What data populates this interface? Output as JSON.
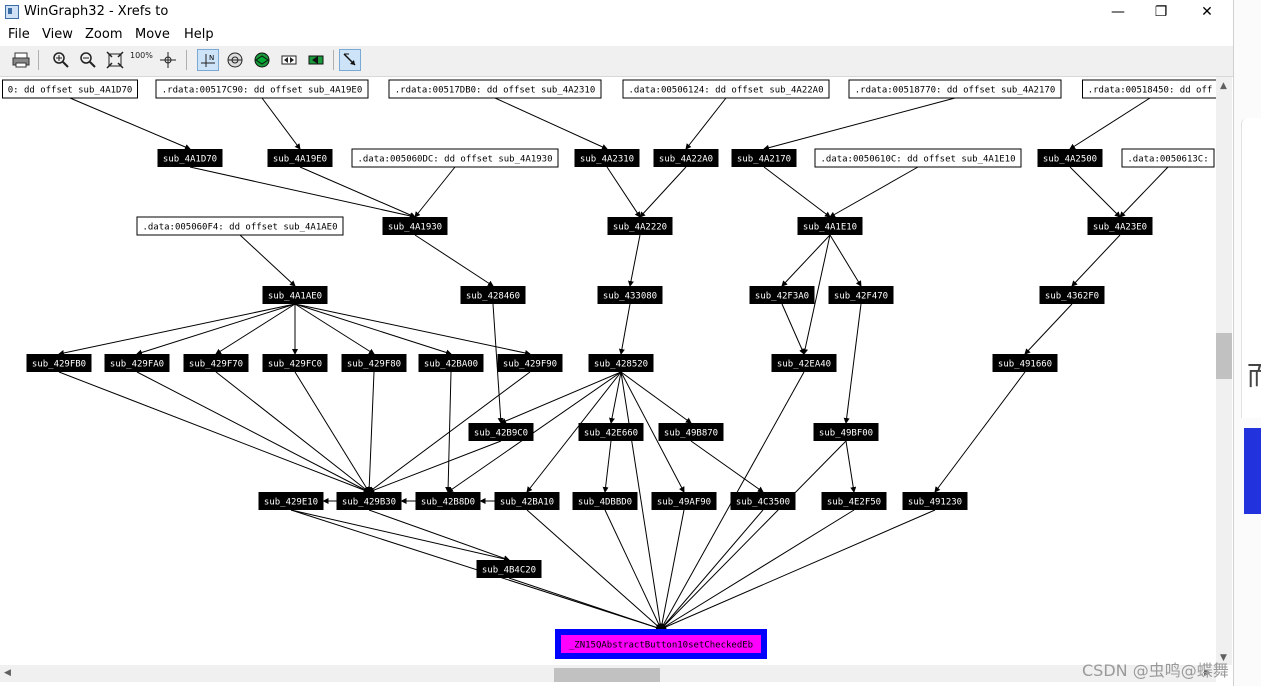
{
  "window": {
    "title": "WinGraph32 - Xrefs to",
    "min_label": "—",
    "max_label": "❐",
    "close_label": "✕"
  },
  "menu": [
    "File",
    "View",
    "Zoom",
    "Move",
    "Help"
  ],
  "toolbar": {
    "zoom_100_label": "100%"
  },
  "graph": {
    "nodes": [
      {
        "id": "n1",
        "label": "0: dd offset sub_4A1D70",
        "kind": "data"
      },
      {
        "id": "n2",
        "label": ".rdata:00517C90: dd offset sub_4A19E0",
        "kind": "data"
      },
      {
        "id": "n3",
        "label": ".rdata:00517DB0: dd offset sub_4A2310",
        "kind": "data"
      },
      {
        "id": "n4",
        "label": ".data:00506124: dd offset sub_4A22A0",
        "kind": "data"
      },
      {
        "id": "n5",
        "label": ".rdata:00518770: dd offset sub_4A2170",
        "kind": "data"
      },
      {
        "id": "n6",
        "label": ".rdata:00518450: dd off",
        "kind": "data"
      },
      {
        "id": "n7",
        "label": "sub_4A1D70",
        "kind": "func"
      },
      {
        "id": "n8",
        "label": "sub_4A19E0",
        "kind": "func"
      },
      {
        "id": "n9",
        "label": ".data:005060DC: dd offset sub_4A1930",
        "kind": "data"
      },
      {
        "id": "n10",
        "label": "sub_4A2310",
        "kind": "func"
      },
      {
        "id": "n11",
        "label": "sub_4A22A0",
        "kind": "func"
      },
      {
        "id": "n12",
        "label": "sub_4A2170",
        "kind": "func"
      },
      {
        "id": "n13",
        "label": ".data:0050610C: dd offset sub_4A1E10",
        "kind": "data"
      },
      {
        "id": "n14",
        "label": "sub_4A2500",
        "kind": "func"
      },
      {
        "id": "n15",
        "label": ".data:0050613C:",
        "kind": "data"
      },
      {
        "id": "n16",
        "label": ".data:005060F4: dd offset sub_4A1AE0",
        "kind": "data"
      },
      {
        "id": "n17",
        "label": "sub_4A1930",
        "kind": "func"
      },
      {
        "id": "n18",
        "label": "sub_4A2220",
        "kind": "func"
      },
      {
        "id": "n19",
        "label": "sub_4A1E10",
        "kind": "func"
      },
      {
        "id": "n20",
        "label": "sub_4A23E0",
        "kind": "func"
      },
      {
        "id": "n21",
        "label": "sub_4A1AE0",
        "kind": "func"
      },
      {
        "id": "n22",
        "label": "sub_428460",
        "kind": "func"
      },
      {
        "id": "n23",
        "label": "sub_433080",
        "kind": "func"
      },
      {
        "id": "n24",
        "label": "sub_42F3A0",
        "kind": "func"
      },
      {
        "id": "n25",
        "label": "sub_42F470",
        "kind": "func"
      },
      {
        "id": "n26",
        "label": "sub_4362F0",
        "kind": "func"
      },
      {
        "id": "n27",
        "label": "sub_429FB0",
        "kind": "func"
      },
      {
        "id": "n28",
        "label": "sub_429FA0",
        "kind": "func"
      },
      {
        "id": "n29",
        "label": "sub_429F70",
        "kind": "func"
      },
      {
        "id": "n30",
        "label": "sub_429FC0",
        "kind": "func"
      },
      {
        "id": "n31",
        "label": "sub_429F80",
        "kind": "func"
      },
      {
        "id": "n32",
        "label": "sub_42BA00",
        "kind": "func"
      },
      {
        "id": "n33",
        "label": "sub_429F90",
        "kind": "func"
      },
      {
        "id": "n34",
        "label": "sub_428520",
        "kind": "func"
      },
      {
        "id": "n35",
        "label": "sub_42EA40",
        "kind": "func"
      },
      {
        "id": "n36",
        "label": "sub_491660",
        "kind": "func"
      },
      {
        "id": "n37",
        "label": "sub_42B9C0",
        "kind": "func"
      },
      {
        "id": "n38",
        "label": "sub_42E660",
        "kind": "func"
      },
      {
        "id": "n39",
        "label": "sub_49B870",
        "kind": "func"
      },
      {
        "id": "n40",
        "label": "sub_49BF00",
        "kind": "func"
      },
      {
        "id": "n41",
        "label": "sub_429E10",
        "kind": "func"
      },
      {
        "id": "n42",
        "label": "sub_429B30",
        "kind": "func"
      },
      {
        "id": "n43",
        "label": "sub_42B8D0",
        "kind": "func"
      },
      {
        "id": "n44",
        "label": "sub_42BA10",
        "kind": "func"
      },
      {
        "id": "n45",
        "label": "sub_4DBBD0",
        "kind": "func"
      },
      {
        "id": "n46",
        "label": "sub_49AF90",
        "kind": "func"
      },
      {
        "id": "n47",
        "label": "sub_4C3500",
        "kind": "func"
      },
      {
        "id": "n48",
        "label": "sub_4E2F50",
        "kind": "func"
      },
      {
        "id": "n49",
        "label": "sub_491230",
        "kind": "func"
      },
      {
        "id": "n50",
        "label": "sub_4B4C20",
        "kind": "func"
      },
      {
        "id": "n51",
        "label": "_ZN15QAbstractButton10setCheckedEb",
        "kind": "target"
      }
    ],
    "edges": [
      [
        "n1",
        "n7"
      ],
      [
        "n2",
        "n8"
      ],
      [
        "n3",
        "n10"
      ],
      [
        "n4",
        "n11"
      ],
      [
        "n5",
        "n12"
      ],
      [
        "n6",
        "n14"
      ],
      [
        "n7",
        "n17"
      ],
      [
        "n8",
        "n17"
      ],
      [
        "n9",
        "n17"
      ],
      [
        "n10",
        "n18"
      ],
      [
        "n11",
        "n18"
      ],
      [
        "n12",
        "n19"
      ],
      [
        "n13",
        "n19"
      ],
      [
        "n14",
        "n20"
      ],
      [
        "n15",
        "n20"
      ],
      [
        "n16",
        "n21"
      ],
      [
        "n17",
        "n22"
      ],
      [
        "n18",
        "n23"
      ],
      [
        "n19",
        "n24"
      ],
      [
        "n19",
        "n25"
      ],
      [
        "n19",
        "n35"
      ],
      [
        "n20",
        "n26"
      ],
      [
        "n21",
        "n27"
      ],
      [
        "n21",
        "n28"
      ],
      [
        "n21",
        "n29"
      ],
      [
        "n21",
        "n30"
      ],
      [
        "n21",
        "n31"
      ],
      [
        "n21",
        "n32"
      ],
      [
        "n21",
        "n33"
      ],
      [
        "n23",
        "n34"
      ],
      [
        "n24",
        "n35"
      ],
      [
        "n26",
        "n36"
      ],
      [
        "n22",
        "n37"
      ],
      [
        "n25",
        "n40"
      ],
      [
        "n34",
        "n37"
      ],
      [
        "n34",
        "n38"
      ],
      [
        "n34",
        "n39"
      ],
      [
        "n34",
        "n44"
      ],
      [
        "n34",
        "n46"
      ],
      [
        "n34",
        "n43"
      ],
      [
        "n34",
        "n51"
      ],
      [
        "n27",
        "n42"
      ],
      [
        "n28",
        "n42"
      ],
      [
        "n29",
        "n42"
      ],
      [
        "n30",
        "n42"
      ],
      [
        "n31",
        "n42"
      ],
      [
        "n32",
        "n43"
      ],
      [
        "n33",
        "n42"
      ],
      [
        "n37",
        "n42"
      ],
      [
        "n38",
        "n45"
      ],
      [
        "n39",
        "n47"
      ],
      [
        "n40",
        "n48"
      ],
      [
        "n36",
        "n49"
      ],
      [
        "n43",
        "n42"
      ],
      [
        "n44",
        "n43"
      ],
      [
        "n42",
        "n41"
      ],
      [
        "n41",
        "n50"
      ],
      [
        "n42",
        "n50"
      ],
      [
        "n50",
        "n51"
      ],
      [
        "n41",
        "n51"
      ],
      [
        "n45",
        "n51"
      ],
      [
        "n46",
        "n51"
      ],
      [
        "n47",
        "n51"
      ],
      [
        "n48",
        "n51"
      ],
      [
        "n49",
        "n51"
      ],
      [
        "n35",
        "n51"
      ],
      [
        "n40",
        "n51"
      ],
      [
        "n44",
        "n51"
      ]
    ]
  },
  "side_panel": {
    "glyph": "而"
  },
  "watermark": "CSDN @虫鸣@蝶舞"
}
